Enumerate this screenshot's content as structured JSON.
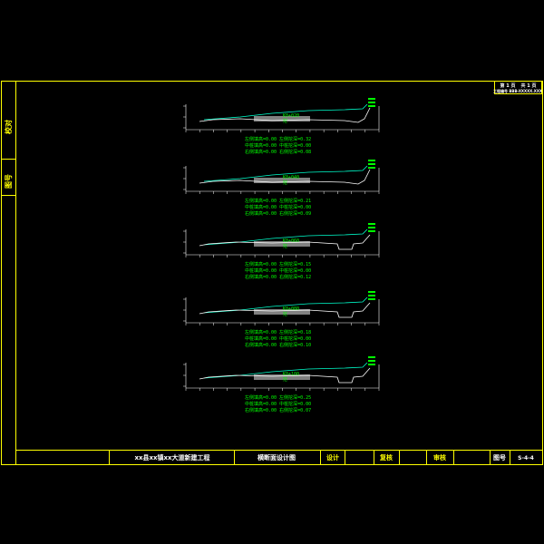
{
  "header": {
    "line1_left": "第 1 页",
    "line1_right": "共 1 页",
    "line2": "工程编号 BBB-XXXXX.XXX"
  },
  "sidebar": {
    "label_top": "校对",
    "label_bottom": "图号"
  },
  "title_block": {
    "project": "xx县xx镇xx大道新建工程",
    "drawing_title": "横断面设计图",
    "design_label": "设计",
    "check_label": "复核",
    "review_label": "审核",
    "sheet_no_label": "图号",
    "sheet_no_value": "S-4-4"
  },
  "sections": [
    {
      "station": "K0+020",
      "tag": "挖",
      "notes": [
        "左侧填高=0.00  左侧挖深=0.32",
        "中桩填高=0.00  中桩挖深=0.00",
        "右侧填高=0.00  右侧挖深=0.08"
      ]
    },
    {
      "station": "K0+040",
      "tag": "挖",
      "notes": [
        "左侧填高=0.00  左侧挖深=0.21",
        "中桩填高=0.00  中桩挖深=0.00",
        "右侧填高=0.00  右侧挖深=0.09"
      ]
    },
    {
      "station": "K0+060",
      "tag": "挖",
      "notes": [
        "左侧填高=0.00  左侧挖深=0.15",
        "中桩填高=0.00  中桩挖深=0.00",
        "右侧填高=0.00  右侧挖深=0.12"
      ]
    },
    {
      "station": "K0+080",
      "tag": "挖",
      "notes": [
        "左侧填高=0.00  左侧挖深=0.18",
        "中桩填高=0.00  中桩挖深=0.00",
        "右侧填高=0.00  右侧挖深=0.10"
      ]
    },
    {
      "station": "K0+100",
      "tag": "挖",
      "notes": [
        "左侧填高=0.00  左侧挖深=0.25",
        "中桩填高=0.00  中桩挖深=0.00",
        "右侧填高=0.00  右侧挖深=0.07"
      ]
    }
  ],
  "colors": {
    "frame": "#ffff00",
    "axis": "#ffffff",
    "design_line": "#00ffcc",
    "ground_line": "#ffffff",
    "text": "#00ff00",
    "band": "#808080"
  }
}
